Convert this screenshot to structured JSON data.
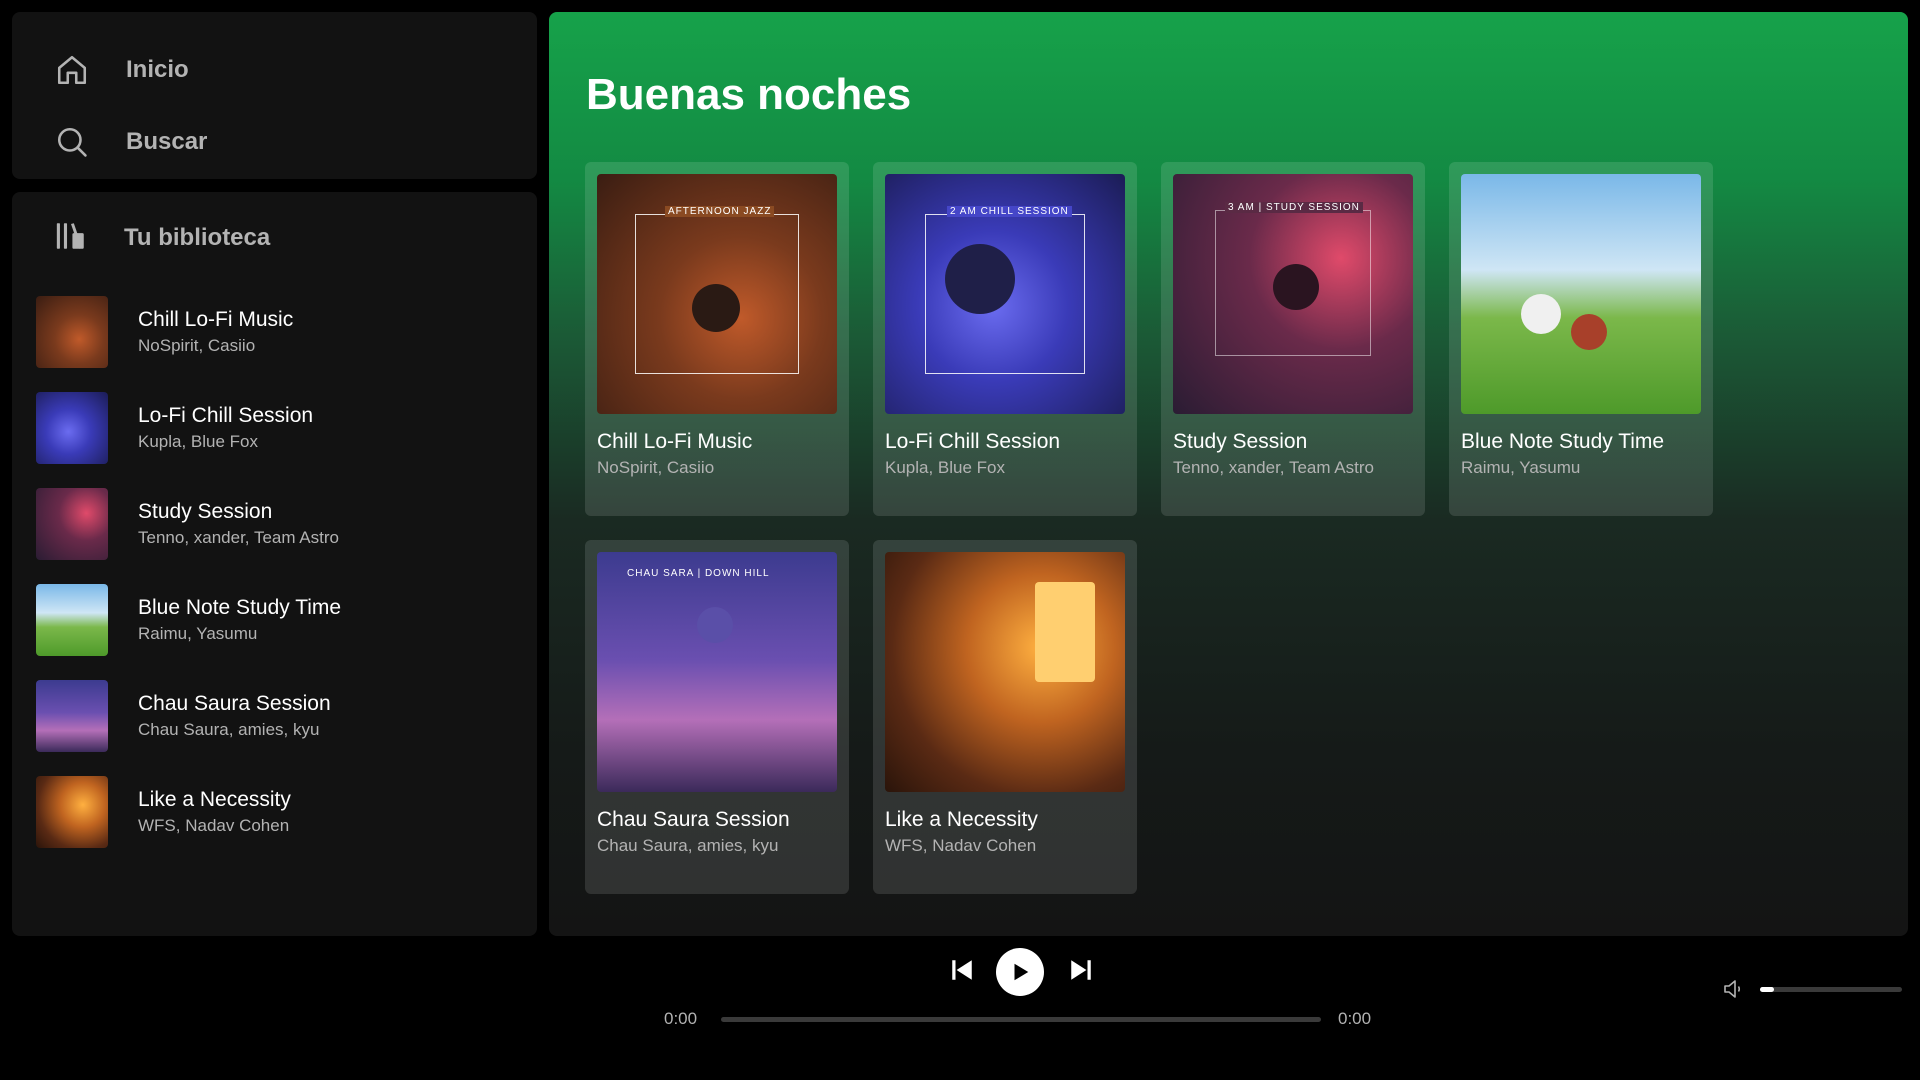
{
  "nav": {
    "home_label": "Inicio",
    "search_label": "Buscar"
  },
  "library": {
    "title": "Tu biblioteca",
    "items": [
      {
        "title": "Chill Lo-Fi Music",
        "artists": "NoSpirit, Casiio"
      },
      {
        "title": "Lo-Fi Chill Session",
        "artists": "Kupla, Blue Fox"
      },
      {
        "title": "Study Session",
        "artists": "Tenno, xander, Team Astro"
      },
      {
        "title": "Blue Note Study Time",
        "artists": "Raimu, Yasumu"
      },
      {
        "title": "Chau Saura Session",
        "artists": "Chau Saura, amies, kyu"
      },
      {
        "title": "Like a Necessity",
        "artists": "WFS, Nadav Cohen"
      }
    ]
  },
  "main": {
    "greeting": "Buenas noches",
    "cards": [
      {
        "title": "Chill Lo-Fi Music",
        "artists": "NoSpirit, Casiio",
        "cover_text": "AFTERNOON JAZZ"
      },
      {
        "title": "Lo-Fi Chill Session",
        "artists": "Kupla, Blue Fox",
        "cover_text": "2 AM CHILL SESSION"
      },
      {
        "title": "Study Session",
        "artists": "Tenno, xander, Team Astro",
        "cover_text": "3 AM | STUDY SESSION"
      },
      {
        "title": "Blue Note Study Time",
        "artists": "Raimu, Yasumu",
        "cover_text": ""
      },
      {
        "title": "Chau Saura Session",
        "artists": "Chau Saura, amies, kyu",
        "cover_text": "CHAU SARA | DOWN HILL"
      },
      {
        "title": "Like a Necessity",
        "artists": "WFS, Nadav Cohen",
        "cover_text": ""
      }
    ]
  },
  "player": {
    "elapsed": "0:00",
    "duration": "0:00",
    "progress": 0,
    "volume": 0.08
  },
  "colors": {
    "accent": "#1db954",
    "background": "#000000",
    "panel": "#121212"
  }
}
